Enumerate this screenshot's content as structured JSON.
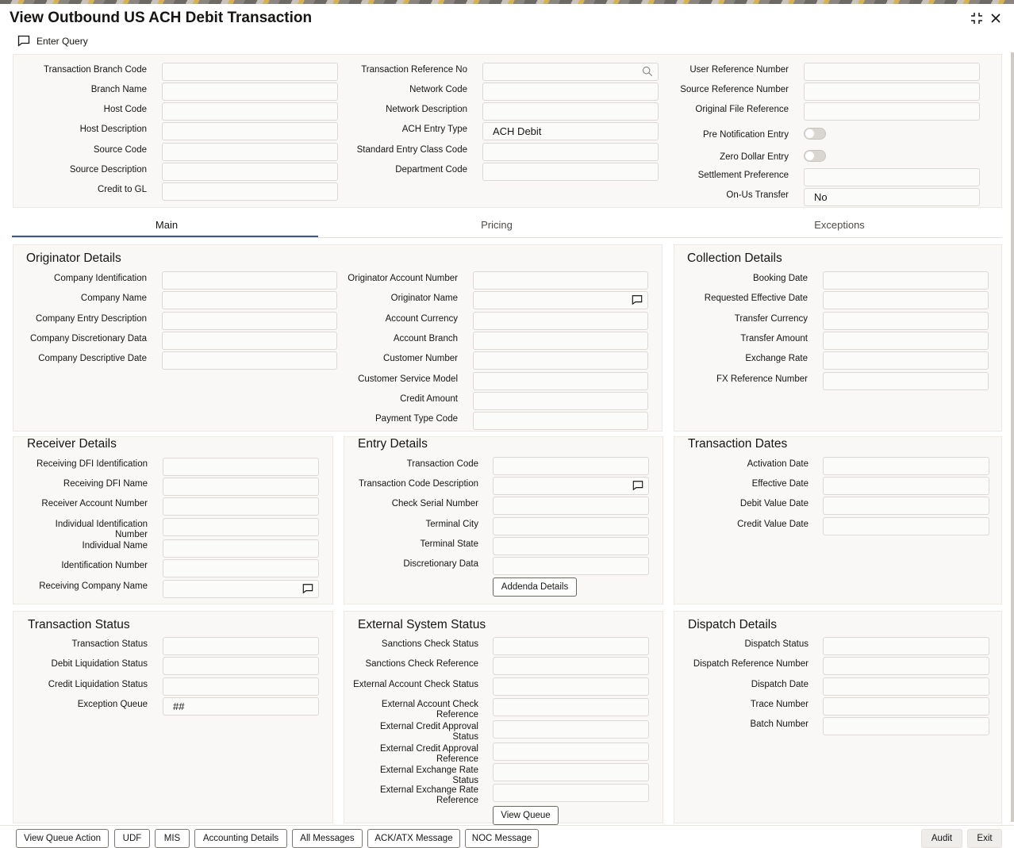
{
  "window": {
    "title": "View Outbound US ACH Debit Transaction"
  },
  "toolbar": {
    "enter_query": "Enter Query"
  },
  "header": {
    "col1": [
      {
        "label": "Transaction Branch Code",
        "value": ""
      },
      {
        "label": "Branch Name",
        "value": ""
      },
      {
        "label": "Host Code",
        "value": ""
      },
      {
        "label": "Host Description",
        "value": ""
      },
      {
        "label": "Source Code",
        "value": ""
      },
      {
        "label": "Source Description",
        "value": ""
      },
      {
        "label": "Credit to GL",
        "value": ""
      }
    ],
    "col2": [
      {
        "label": "Transaction Reference No",
        "value": ""
      },
      {
        "label": "Network Code",
        "value": ""
      },
      {
        "label": "Network Description",
        "value": ""
      },
      {
        "label": "ACH Entry Type",
        "value": "ACH Debit"
      },
      {
        "label": "Standard Entry Class Code",
        "value": ""
      },
      {
        "label": "Department Code",
        "value": ""
      }
    ],
    "col3": [
      {
        "label": "User Reference Number",
        "value": ""
      },
      {
        "label": "Source Reference Number",
        "value": ""
      },
      {
        "label": "Original File Reference",
        "value": ""
      },
      {
        "label": "Pre Notification Entry",
        "value": ""
      },
      {
        "label": "Zero Dollar Entry",
        "value": ""
      },
      {
        "label": "Settlement Preference",
        "value": ""
      },
      {
        "label": "On-Us Transfer",
        "value": "No"
      }
    ]
  },
  "tabs": [
    "Main",
    "Pricing",
    "Exceptions"
  ],
  "originator": {
    "title": "Originator Details",
    "left": [
      "Company Identification",
      "Company Name",
      "Company Entry Description",
      "Company Discretionary Data",
      "Company Descriptive Date"
    ],
    "right": [
      "Originator Account Number",
      "Originator Name",
      "Account Currency",
      "Account Branch",
      "Customer Number",
      "Customer Service Model",
      "Credit Amount",
      "Payment Type Code"
    ]
  },
  "collection": {
    "title": "Collection Details",
    "fields": [
      "Booking Date",
      "Requested Effective Date",
      "Transfer Currency",
      "Transfer Amount",
      "Exchange Rate",
      "FX Reference Number"
    ]
  },
  "receiver": {
    "title": "Receiver Details",
    "fields": [
      "Receiving DFI Identification",
      "Receiving DFI Name",
      "Receiver Account Number",
      "Individual Identification Number",
      "Individual Name",
      "Identification Number",
      "Receiving Company Name"
    ]
  },
  "entry": {
    "title": "Entry Details",
    "fields": [
      "Transaction Code",
      "Transaction Code Description",
      "Check Serial Number",
      "Terminal City",
      "Terminal State",
      "Discretionary Data"
    ],
    "addenda_button": "Addenda Details"
  },
  "dates": {
    "title": "Transaction Dates",
    "fields": [
      "Activation Date",
      "Effective Date",
      "Debit Value Date",
      "Credit Value Date"
    ]
  },
  "status": {
    "title": "Transaction Status",
    "fields": [
      "Transaction Status",
      "Debit Liquidation Status",
      "Credit Liquidation Status",
      "Exception Queue"
    ],
    "exception_queue_value": "##"
  },
  "external": {
    "title": "External System Status",
    "fields": [
      "Sanctions Check Status",
      "Sanctions Check Reference",
      "External Account Check Status",
      "External Account Check Reference",
      "External Credit Approval Status",
      "External Credit Approval Reference",
      "External Exchange Rate Status",
      "External Exchange Rate Reference"
    ],
    "view_queue_button": "View Queue"
  },
  "dispatch": {
    "title": "Dispatch Details",
    "fields": [
      "Dispatch Status",
      "Dispatch Reference Number",
      "Dispatch Date",
      "Trace Number",
      "Batch Number"
    ]
  },
  "footer": {
    "left": [
      "View Queue Action",
      "UDF",
      "MIS",
      "Accounting Details",
      "All Messages",
      "ACK/ATX Message",
      "NOC Message"
    ],
    "right": [
      "Audit",
      "Exit"
    ]
  },
  "colors": {
    "tab_active_underline": "#3d5b8a",
    "panel_bg": "#f9f8f6"
  }
}
